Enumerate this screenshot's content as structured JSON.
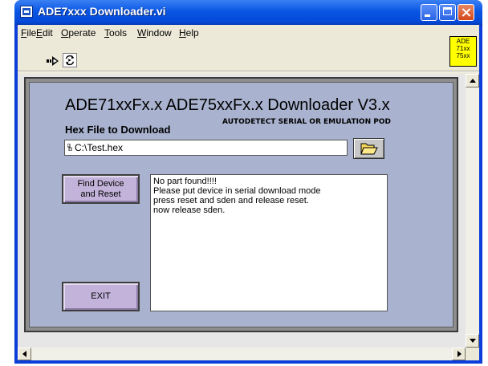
{
  "window": {
    "title": "ADE7xxx Downloader.vi"
  },
  "menu": [
    "File",
    "Edit",
    "Operate",
    "Tools",
    "Window",
    "Help"
  ],
  "vi_icon": [
    "ADE",
    "71xx",
    "75xx"
  ],
  "panel": {
    "heading": "ADE71xxFx.x ADE75xxFx.x Downloader V3.x",
    "autodetect": "AUTODETECT SERIAL OR EMULATION POD",
    "hex_label": "Hex File to Download",
    "hex_path": "C:\\Test.hex",
    "find_button": [
      "Find Device",
      "and Reset"
    ],
    "exit_button": "EXIT",
    "status_lines": [
      "No part found!!!!",
      "Please put device in serial download mode",
      "press reset and sden and release reset.",
      "now release sden."
    ]
  },
  "colors": {
    "panel_bg": "#a9b3cf",
    "button_bg": "#c3b3da",
    "vi_icon_bg": "#ffff00"
  },
  "icons": [
    "run-arrow-icon",
    "run-continuously-icon",
    "folder-open-icon"
  ]
}
